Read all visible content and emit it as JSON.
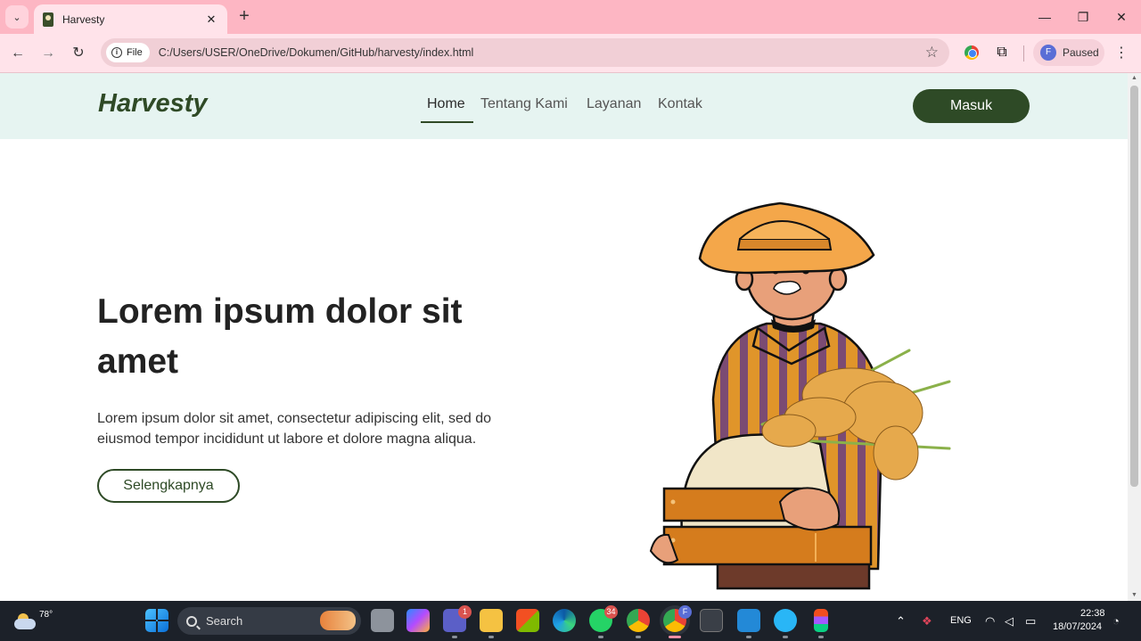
{
  "browser": {
    "tab_title": "Harvesty",
    "site_chip": "File",
    "url": "C:/Users/USER/OneDrive/Dokumen/GitHub/harvesty/index.html",
    "profile_initial": "F",
    "profile_status": "Paused"
  },
  "page": {
    "logo": "Harvesty",
    "nav": [
      {
        "label": "Home",
        "active": true
      },
      {
        "label": "Tentang Kami",
        "active": false
      },
      {
        "label": "Layanan",
        "active": false
      },
      {
        "label": "Kontak",
        "active": false
      }
    ],
    "login_button": "Masuk",
    "hero": {
      "title": "Lorem ipsum dolor sit amet",
      "description": "Lorem ipsum dolor sit amet, consectetur adipiscing elit, sed do eiusmod tempor incididunt ut labore et dolore magna aliqua.",
      "cta": "Selengkapnya"
    },
    "colors": {
      "primary": "#2e4a26",
      "navbar_bg": "#e6f4f1"
    }
  },
  "taskbar": {
    "weather_temp": "78°",
    "search_placeholder": "Search",
    "teams_badge": "1",
    "whatsapp_badge": "34",
    "chrome_profile_badge": "F",
    "language": "ENG",
    "time": "22:38",
    "date": "18/07/2024"
  }
}
